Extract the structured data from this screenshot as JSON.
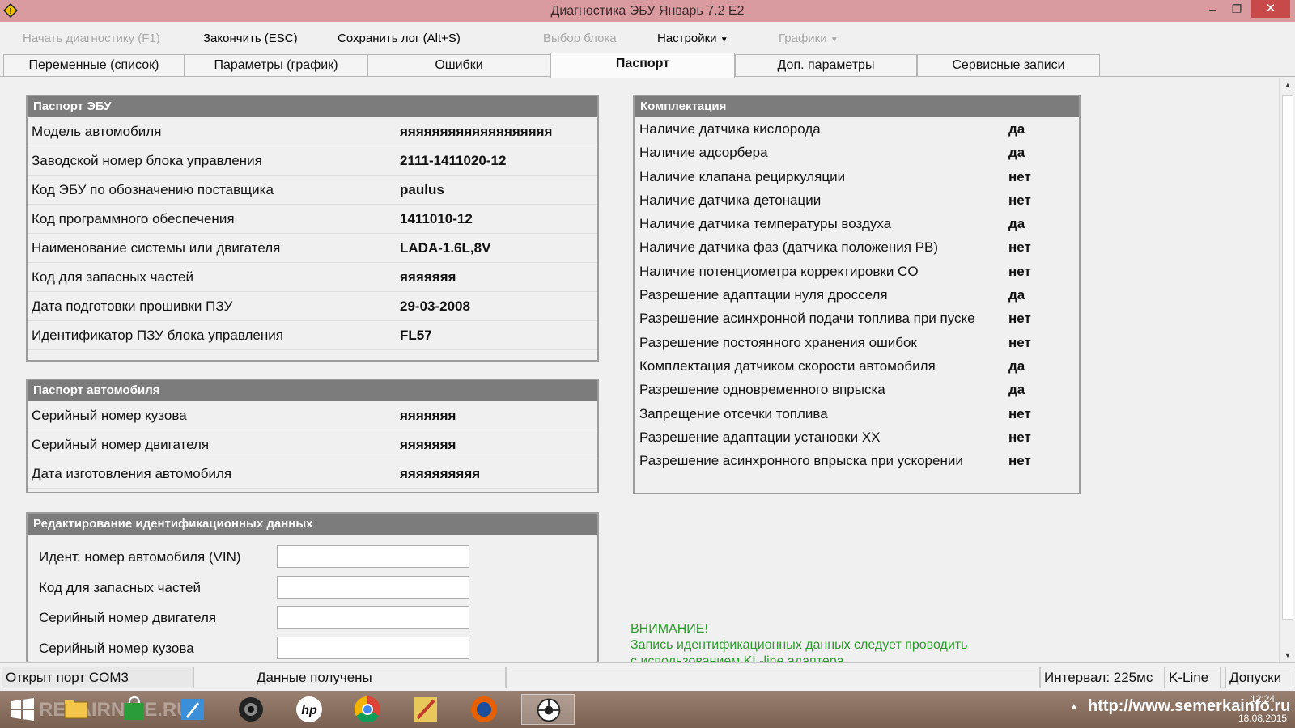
{
  "window": {
    "title": "Диагностика ЭБУ Январь 7.2 E2",
    "minimize": "‒",
    "maximize": "❐",
    "close": "✕"
  },
  "menu": {
    "start_diag": "Начать диагностику (F1)",
    "finish": "Закончить (ESC)",
    "save_log": "Сохранить лог (Alt+S)",
    "select_block": "Выбор блока",
    "settings": "Настройки",
    "graphs": "Графики"
  },
  "tabs": [
    {
      "label": "Переменные (список)"
    },
    {
      "label": "Параметры (график)"
    },
    {
      "label": "Ошибки"
    },
    {
      "label": "Паспорт"
    },
    {
      "label": "Доп. параметры"
    },
    {
      "label": "Сервисные записи"
    }
  ],
  "ecu_passport": {
    "title": "Паспорт ЭБУ",
    "rows": [
      {
        "label": "Модель автомобиля",
        "value": "яяяяяяяяяяяяяяяяяяя"
      },
      {
        "label": "Заводской номер блока управления",
        "value": "2111-1411020-12"
      },
      {
        "label": "Код ЭБУ по обозначению поставщика",
        "value": "paulus"
      },
      {
        "label": "Код программного обеспечения",
        "value": "1411010-12"
      },
      {
        "label": "Наименование системы или двигателя",
        "value": "LADA-1.6L,8V"
      },
      {
        "label": "Код для запасных частей",
        "value": "яяяяяяя"
      },
      {
        "label": "Дата подготовки прошивки ПЗУ",
        "value": "29-03-2008"
      },
      {
        "label": "Идентификатор ПЗУ блока управления",
        "value": "FL57"
      }
    ]
  },
  "car_passport": {
    "title": "Паспорт автомобиля",
    "rows": [
      {
        "label": "Серийный номер кузова",
        "value": "яяяяяяя"
      },
      {
        "label": "Серийный номер двигателя",
        "value": "яяяяяяя"
      },
      {
        "label": "Дата изготовления автомобиля",
        "value": "яяяяяяяяяя"
      }
    ]
  },
  "edit_ident": {
    "title": "Редактирование идентификационных данных",
    "fields": [
      {
        "label": "Идент. номер автомобиля (VIN)",
        "value": ""
      },
      {
        "label": "Код для запасных частей",
        "value": ""
      },
      {
        "label": "Серийный номер двигателя",
        "value": ""
      },
      {
        "label": "Серийный номер кузова",
        "value": ""
      }
    ]
  },
  "equipment": {
    "title": "Комплектация",
    "rows": [
      {
        "label": "Наличие датчика кислорода",
        "value": "да"
      },
      {
        "label": "Наличие адсорбера",
        "value": "да"
      },
      {
        "label": "Наличие клапана рециркуляции",
        "value": "нет"
      },
      {
        "label": "Наличие датчика детонации",
        "value": "нет"
      },
      {
        "label": "Наличие датчика температуры воздуха",
        "value": "да"
      },
      {
        "label": "Наличие датчика фаз (датчика положения РВ)",
        "value": "нет"
      },
      {
        "label": "Наличие потенциометра корректировки CO",
        "value": "нет"
      },
      {
        "label": "Разрешение адаптации нуля дросселя",
        "value": "да"
      },
      {
        "label": "Разрешение асинхронной подачи топлива при пуске",
        "value": "нет"
      },
      {
        "label": "Разрешение постоянного хранения ошибок",
        "value": "нет"
      },
      {
        "label": "Комплектация датчиком скорости автомобиля",
        "value": "да"
      },
      {
        "label": "Разрешение одновременного впрыска",
        "value": "да"
      },
      {
        "label": "Запрещение отсечки топлива",
        "value": "нет"
      },
      {
        "label": "Разрешение адаптации установки XX",
        "value": "нет"
      },
      {
        "label": "Разрешение асинхронного впрыска при ускорении",
        "value": "нет"
      }
    ]
  },
  "warning": {
    "title": "ВНИМАНИЕ!",
    "line1": "Запись идентификационных данных следует проводить",
    "line2": "с использованием KL-line адаптера"
  },
  "status": {
    "port": "Открыт порт COM3",
    "data": "Данные получены",
    "interval": "Интервал: 225мс",
    "line": "K-Line",
    "tolerances": "Допуски"
  },
  "taskbar": {
    "watermark": "REPAIRNICE.RU",
    "url": "http://www.semerkainfo.ru",
    "time": "12:24",
    "date": "18.08.2015",
    "icons": [
      "windows-start-icon",
      "explorer-icon",
      "store-icon",
      "rocket-icon",
      "camera-icon",
      "hp-icon",
      "chrome-icon",
      "sumatra-icon",
      "firefox-icon",
      "diagnostic-app-icon"
    ]
  },
  "colors": {
    "titlebar": "#d99aa0",
    "group_header": "#7c7c7c",
    "warning_text": "#2e9a2e"
  }
}
